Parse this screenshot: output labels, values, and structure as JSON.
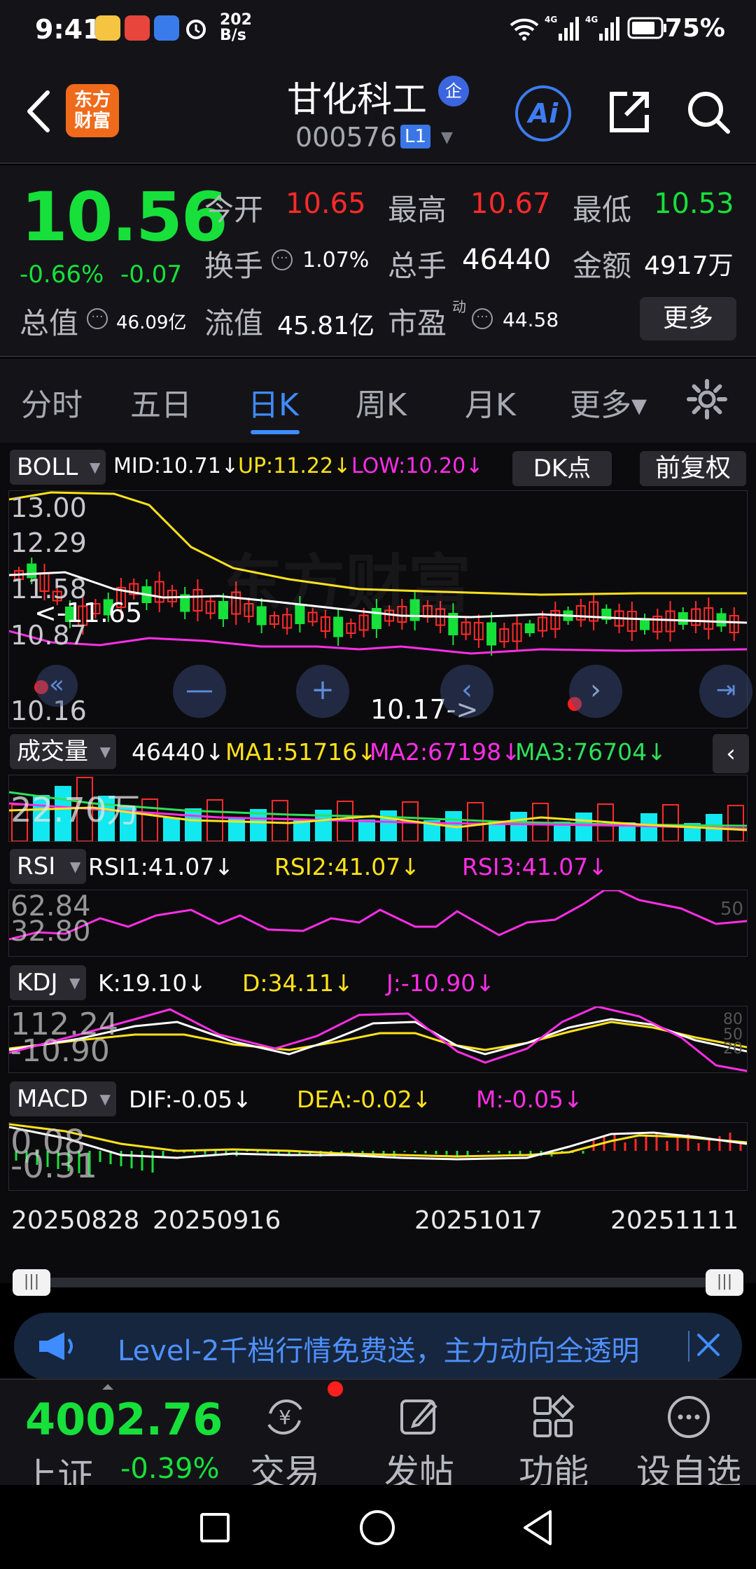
{
  "status_bar": {
    "time": "9:41",
    "net_speed_value": "202",
    "net_speed_unit": "B/s",
    "battery": "75%"
  },
  "header": {
    "logo_text_top": "东方",
    "logo_text_bottom": "财富",
    "stock_name": "甘化科工",
    "badge": "企",
    "stock_code": "000576",
    "level": "L1",
    "ai_label": "Ai"
  },
  "quote": {
    "price": "10.56",
    "change_pct": "-0.66%",
    "change_abs": "-0.07",
    "open_label": "今开",
    "open": "10.65",
    "high_label": "最高",
    "high": "10.67",
    "low_label": "最低",
    "low": "10.53",
    "turnover_label": "换手",
    "turnover": "1.07%",
    "volume_label": "总手",
    "volume": "46440",
    "amount_label": "金额",
    "amount": "4917万",
    "mktcap_label": "总值",
    "mktcap": "46.09亿",
    "float_label": "流值",
    "float": "45.81亿",
    "pe_label": "市盈",
    "pe_sup": "动",
    "pe": "44.58",
    "more": "更多"
  },
  "tabs": [
    {
      "label": "分时"
    },
    {
      "label": "五日"
    },
    {
      "label": "日K"
    },
    {
      "label": "周K"
    },
    {
      "label": "月K"
    },
    {
      "label": "更多▾"
    }
  ],
  "boll": {
    "name": "BOLL",
    "mid": "MID:10.71↓",
    "up": "UP:11.22↓",
    "low": "LOW:10.20↓",
    "dk": "DK点",
    "adjust": "前复权",
    "axis": [
      "13.00",
      "12.29",
      "11.58",
      "10.87",
      "10.16"
    ],
    "high_marker": "<-11.65",
    "low_marker": "10.17->",
    "watermark": "东方财富"
  },
  "volume": {
    "name": "成交量",
    "value": "46440↓",
    "ma1": "MA1:51716↓",
    "ma2": "MA2:67198↓",
    "ma3": "MA3:76704↓",
    "axis": "22.70万"
  },
  "rsi": {
    "name": "RSI",
    "rsi1": "RSI1:41.07↓",
    "rsi2": "RSI2:41.07↓",
    "rsi3": "RSI3:41.07↓",
    "axis_top": "62.84",
    "axis_bottom": "32.80",
    "ref": "50"
  },
  "kdj": {
    "name": "KDJ",
    "k": "K:19.10↓",
    "d": "D:34.11↓",
    "j": "J:-10.90↓",
    "axis_top": "112.24",
    "axis_bottom": "-10.90",
    "ref_top": "80",
    "ref_mid": "50",
    "ref_low": "20"
  },
  "macd": {
    "name": "MACD",
    "dif": "DIF:-0.05↓",
    "dea": "DEA:-0.02↓",
    "m": "M:-0.05↓",
    "axis_top": "0.08",
    "axis_bottom": "-0.31"
  },
  "dates": [
    "20250828",
    "20250916",
    "20251017",
    "20251111"
  ],
  "banner": {
    "text": "Level-2千档行情免费送，主力动向全透明"
  },
  "bottom": {
    "index_value": "4002.76",
    "index_name": "上证",
    "index_change": "-0.39%",
    "nav": [
      {
        "label": "交易"
      },
      {
        "label": "发帖"
      },
      {
        "label": "功能"
      },
      {
        "label": "设自选"
      }
    ]
  },
  "colors": {
    "up": "#ff2a2a",
    "down": "#17e03a",
    "accent": "#3f8cff",
    "boll_up": "#ffe21a",
    "boll_low": "#ff2ee6"
  }
}
